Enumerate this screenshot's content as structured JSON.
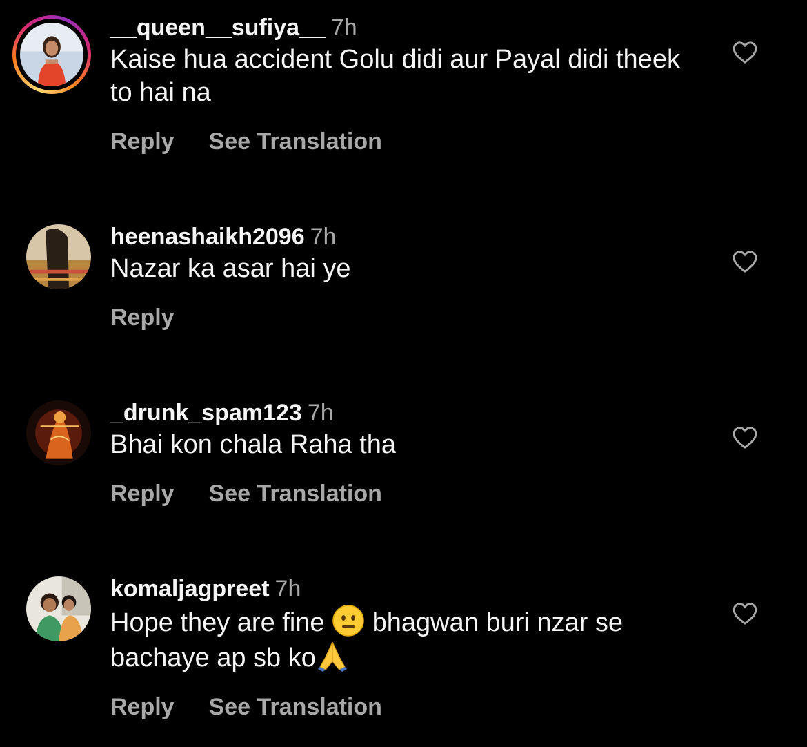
{
  "comments": [
    {
      "username": "__queen__sufiya__",
      "time": "7h",
      "text_parts": [
        "Kaise hua accident Golu didi aur Payal didi theek to hai na"
      ],
      "reply_label": "Reply",
      "translation_label": "See Translation",
      "has_story_ring": true
    },
    {
      "username": "heenashaikh2096",
      "time": "7h",
      "text_parts": [
        "Nazar ka asar hai ye"
      ],
      "reply_label": "Reply",
      "has_story_ring": false
    },
    {
      "username": "_drunk_spam123",
      "time": "7h",
      "text_parts": [
        "Bhai kon chala Raha tha"
      ],
      "reply_label": "Reply",
      "translation_label": "See Translation",
      "has_story_ring": false
    },
    {
      "username": "komaljagpreet",
      "time": "7h",
      "text_parts": [
        "Hope they are fine ",
        " bhagwan buri nzar se bachaye ap sb ko"
      ],
      "emojis": [
        "neutral-face-emoji",
        "folded-hands-emoji"
      ],
      "reply_label": "Reply",
      "translation_label": "See Translation",
      "has_story_ring": false
    }
  ],
  "colors": {
    "background": "#000000",
    "primary_text": "#f5f5f5",
    "secondary_text": "#a8a8a8"
  }
}
